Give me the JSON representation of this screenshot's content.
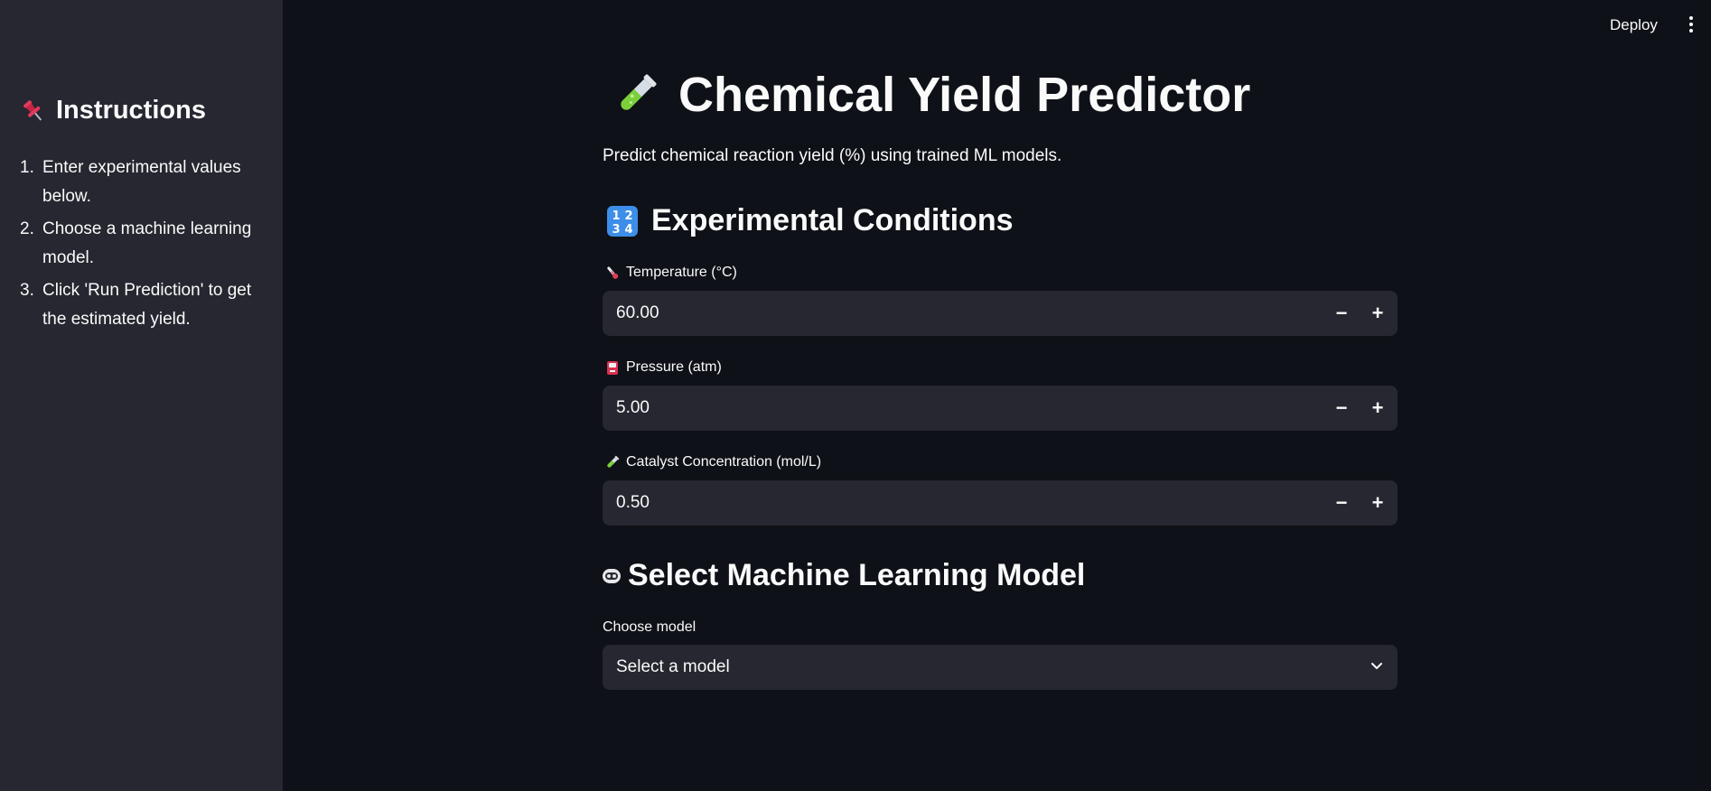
{
  "topbar": {
    "deploy_label": "Deploy"
  },
  "sidebar": {
    "title": "Instructions",
    "title_icon": "pushpin-icon",
    "items": [
      {
        "num": "1.",
        "text": "Enter experimental values below."
      },
      {
        "num": "2.",
        "text": "Choose a machine learning model."
      },
      {
        "num": "3.",
        "text": "Click 'Run Prediction' to get the estimated yield."
      }
    ]
  },
  "main": {
    "title": "Chemical Yield Predictor",
    "title_icon": "test-tube-icon",
    "subtitle": "Predict chemical reaction yield (%) using trained ML models.",
    "conditions_heading": "Experimental Conditions",
    "conditions_icon": "numbers-keycap-icon",
    "fields": [
      {
        "label": "Temperature (°C)",
        "icon": "thermometer-icon",
        "value": "60.00"
      },
      {
        "label": "Pressure (atm)",
        "icon": "gauge-icon",
        "value": "5.00"
      },
      {
        "label": "Catalyst Concentration (mol/L)",
        "icon": "test-tube-icon",
        "value": "0.50"
      }
    ],
    "model_heading": "Select Machine Learning Model",
    "model_icon": "robot-icon",
    "model_select": {
      "label": "Choose model",
      "value": "Select a model"
    }
  },
  "colors": {
    "background": "#0e1117",
    "sidebar": "#262730",
    "input_bg": "#262730",
    "text": "#fafafa"
  }
}
